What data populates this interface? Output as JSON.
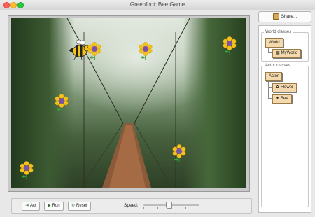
{
  "window": {
    "title": "Greenfoot: Bee Game"
  },
  "share": {
    "label": "Share...",
    "icon": "share-icon"
  },
  "world_classes": {
    "group_label": "World classes",
    "items": [
      {
        "label": "World",
        "icon": ""
      },
      {
        "label": "MyWorld",
        "icon": "world-thumbnail-icon"
      }
    ]
  },
  "actor_classes": {
    "group_label": "Actor classes",
    "items": [
      {
        "label": "Actor",
        "icon": ""
      },
      {
        "label": "Flower",
        "icon": "flower-icon"
      },
      {
        "label": "Bee",
        "icon": "bee-icon"
      }
    ]
  },
  "controls": {
    "act_label": "Act",
    "run_label": "Run",
    "reset_label": "Reset",
    "speed_label": "Speed:",
    "speed_value": 0.45
  },
  "colors": {
    "class_fill": "#f3d9ad",
    "class_border": "#9b7a45",
    "petal": "#f6c21a",
    "center": "#7a52a8"
  }
}
